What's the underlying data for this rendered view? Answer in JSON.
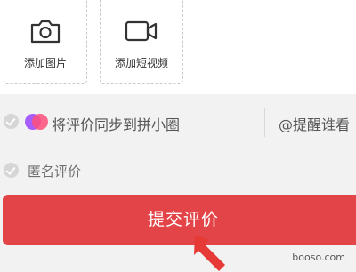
{
  "upload": {
    "photo": {
      "label": "添加图片",
      "icon": "camera-icon"
    },
    "video": {
      "label": "添加短视频",
      "icon": "video-camera-icon"
    }
  },
  "options": {
    "sync": {
      "label": "将评价同步到拼小圈",
      "logo": "pinduoduo-circle-logo",
      "checked": false
    },
    "mention": {
      "label": "@提醒谁看"
    },
    "anonymous": {
      "label": "匿名评价",
      "checked": false
    }
  },
  "submit": {
    "label": "提交评价"
  },
  "watermark": "booso.com",
  "colors": {
    "accent": "#e34447",
    "check_inactive": "#d6d6d6",
    "arrow": "#e53a35"
  }
}
